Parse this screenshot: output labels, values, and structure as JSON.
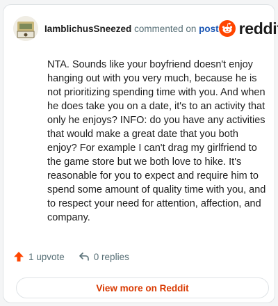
{
  "comment": {
    "username": "IamblichusSneezed",
    "action_text": "commented on",
    "post_link": "post",
    "brand": "reddit",
    "body": "NTA. Sounds like your boyfriend doesn't enjoy hanging out with you very much, because he is not prioritizing spending time with you. And when he does take you on a date, it's to an activity that only he enjoys? INFO: do you have any activities that would make a great date that you both enjoy? For example I can't drag my girlfriend to the game store but we both love to hike. It's reasonable for you to expect and require him to spend some amount of quality time with you, and to respect your need for attention, affection, and company.",
    "upvotes_label": "1 upvote",
    "replies_label": "0 replies",
    "view_more_label": "View more on Reddit"
  },
  "icons": {
    "avatar": "avatar-snoo",
    "brand_logo": "reddit-snoo-icon",
    "upvote": "upvote-arrow-icon",
    "reply": "reply-arrow-icon"
  },
  "colors": {
    "brand_orange": "#ff4500",
    "upvote_orange": "#ff4500",
    "link_blue": "#1a56b4",
    "view_more_text": "#d93900",
    "muted_text": "#576f76"
  }
}
